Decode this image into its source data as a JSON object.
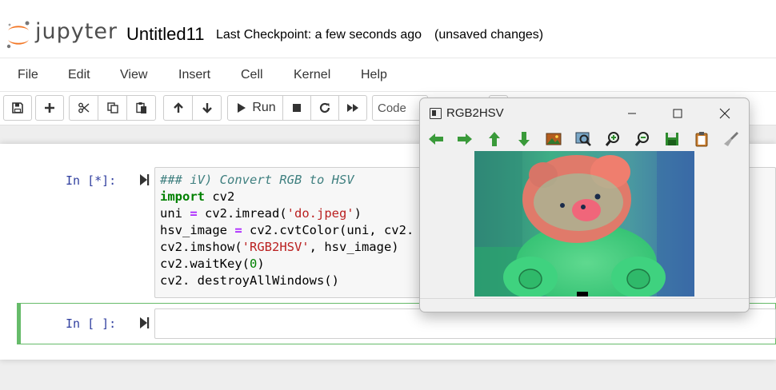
{
  "header": {
    "logo_text": "jupyter",
    "notebook_title": "Untitled11",
    "checkpoint": "Last Checkpoint: a few seconds ago",
    "status": "(unsaved changes)"
  },
  "menubar": {
    "items": [
      "File",
      "Edit",
      "View",
      "Insert",
      "Cell",
      "Kernel",
      "Help"
    ]
  },
  "toolbar": {
    "run_label": "Run",
    "cell_type": "Code",
    "icons": [
      "save-icon",
      "plus-icon",
      "scissors-icon",
      "copy-icon",
      "paste-icon",
      "arrow-up-icon",
      "arrow-down-icon",
      "run-icon",
      "stop-icon",
      "restart-icon",
      "fast-forward-icon"
    ]
  },
  "cells": [
    {
      "prompt": "In [*]:",
      "lines": [
        "### iV) Convert RGB to HSV",
        "import cv2",
        "uni = cv2.imread('do.jpeg')",
        "hsv_image = cv2.cvtColor(uni, cv2.",
        "cv2.imshow('RGB2HSV', hsv_image)",
        "cv2.waitKey(0)",
        "cv2. destroyAllWindows()"
      ]
    },
    {
      "prompt": "In [ ]:",
      "lines": []
    }
  ],
  "image_window": {
    "title": "RGB2HSV",
    "tools": [
      "arrow-left-icon",
      "arrow-right-icon",
      "arrow-up-icon",
      "arrow-down-icon",
      "image-icon",
      "zoom-fit-icon",
      "zoom-in-icon",
      "zoom-out-icon",
      "save-icon",
      "copy-icon",
      "properties-icon"
    ],
    "accent_color": "#2e9e2e"
  }
}
